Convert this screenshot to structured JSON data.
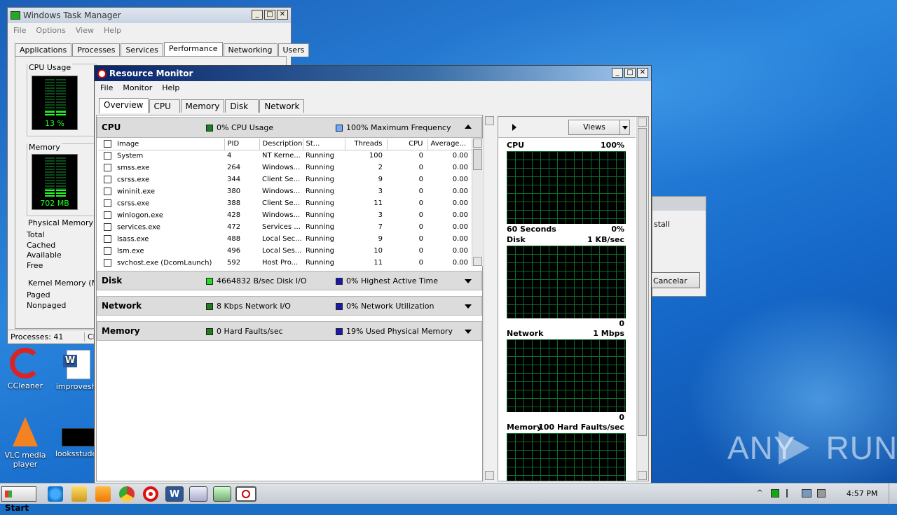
{
  "task_manager": {
    "title": "Windows Task Manager",
    "menu": [
      "File",
      "Options",
      "View",
      "Help"
    ],
    "tabs": [
      "Applications",
      "Processes",
      "Services",
      "Performance",
      "Networking",
      "Users"
    ],
    "active_tab": "Performance",
    "cpu_usage_label": "CPU Usage",
    "cpu_usage_value": "13 %",
    "memory_label": "Memory",
    "memory_value": "702 MB",
    "physical_memory_label": "Physical Memory (M",
    "physical_rows": [
      "Total",
      "Cached",
      "Available",
      "Free"
    ],
    "kernel_memory_label": "Kernel Memory (MB",
    "kernel_rows": [
      "Paged",
      "Nonpaged"
    ],
    "status_processes": "Processes: 41",
    "status_cpu": "CF"
  },
  "resource_monitor": {
    "title": "Resource Monitor",
    "menu": [
      "File",
      "Monitor",
      "Help"
    ],
    "tabs": [
      "Overview",
      "CPU",
      "Memory",
      "Disk",
      "Network"
    ],
    "active_tab": "Overview",
    "cpu_section": {
      "title": "CPU",
      "stat1": "0% CPU Usage",
      "stat2": "100% Maximum Frequency",
      "stat1_color": "#1e7d1e",
      "stat2_color": "#6fa8ff"
    },
    "table_headers": [
      "Image",
      "PID",
      "Description",
      "St...",
      "Threads",
      "CPU",
      "Average..."
    ],
    "processes": [
      {
        "image": "System",
        "pid": "4",
        "desc": "NT Kerne...",
        "status": "Running",
        "threads": "100",
        "cpu": "0",
        "avg": "0.00"
      },
      {
        "image": "smss.exe",
        "pid": "264",
        "desc": "Windows...",
        "status": "Running",
        "threads": "2",
        "cpu": "0",
        "avg": "0.00"
      },
      {
        "image": "csrss.exe",
        "pid": "344",
        "desc": "Client Se...",
        "status": "Running",
        "threads": "9",
        "cpu": "0",
        "avg": "0.00"
      },
      {
        "image": "wininit.exe",
        "pid": "380",
        "desc": "Windows...",
        "status": "Running",
        "threads": "3",
        "cpu": "0",
        "avg": "0.00"
      },
      {
        "image": "csrss.exe",
        "pid": "388",
        "desc": "Client Se...",
        "status": "Running",
        "threads": "11",
        "cpu": "0",
        "avg": "0.00"
      },
      {
        "image": "winlogon.exe",
        "pid": "428",
        "desc": "Windows...",
        "status": "Running",
        "threads": "3",
        "cpu": "0",
        "avg": "0.00"
      },
      {
        "image": "services.exe",
        "pid": "472",
        "desc": "Services ...",
        "status": "Running",
        "threads": "7",
        "cpu": "0",
        "avg": "0.00"
      },
      {
        "image": "lsass.exe",
        "pid": "488",
        "desc": "Local Sec...",
        "status": "Running",
        "threads": "9",
        "cpu": "0",
        "avg": "0.00"
      },
      {
        "image": "lsm.exe",
        "pid": "496",
        "desc": "Local Ses...",
        "status": "Running",
        "threads": "10",
        "cpu": "0",
        "avg": "0.00"
      },
      {
        "image": "svchost.exe (DcomLaunch)",
        "pid": "592",
        "desc": "Host Pro...",
        "status": "Running",
        "threads": "11",
        "cpu": "0",
        "avg": "0.00"
      }
    ],
    "disk_section": {
      "title": "Disk",
      "stat1": "4664832 B/sec Disk I/O",
      "stat2": "0% Highest Active Time",
      "stat1_color": "#22dd22",
      "stat2_color": "#1a1aa8"
    },
    "network_section": {
      "title": "Network",
      "stat1": "8 Kbps Network I/O",
      "stat2": "0% Network Utilization",
      "stat1_color": "#1e7d1e",
      "stat2_color": "#1a1aa8"
    },
    "memory_section": {
      "title": "Memory",
      "stat1": "0 Hard Faults/sec",
      "stat2": "19% Used Physical Memory",
      "stat1_color": "#1e7d1e",
      "stat2_color": "#1a1aa8"
    },
    "views_label": "Views",
    "graphs": {
      "cpu_title": "CPU",
      "cpu_max": "100%",
      "cpu_time": "60 Seconds",
      "cpu_min": "0%",
      "disk_title": "Disk",
      "disk_max": "1 KB/sec",
      "disk_min": "0",
      "network_title": "Network",
      "network_max": "1 Mbps",
      "network_min": "0",
      "memory_title": "Memory",
      "memory_max": "100 Hard Faults/sec"
    }
  },
  "dialog_partial": {
    "text": "stall",
    "button": "Cancelar"
  },
  "desktop_icons": [
    {
      "label": "CCleaner"
    },
    {
      "label": "improveshe"
    },
    {
      "label": "VLC media player"
    },
    {
      "label": "looksstuden"
    }
  ],
  "watermark": "ANY RUN",
  "taskbar": {
    "start_label": "Start",
    "clock": "4:57 PM"
  }
}
